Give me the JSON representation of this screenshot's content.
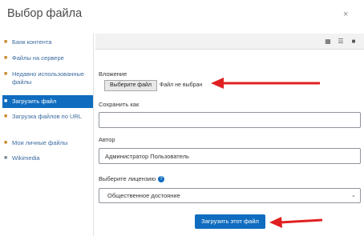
{
  "dialog": {
    "title": "Выбор файла",
    "close_icon": "×"
  },
  "sidebar": {
    "items": [
      {
        "label": "Банк контента",
        "icon": "folder-icon"
      },
      {
        "label": "Файлы на сервере",
        "icon": "folder-icon"
      },
      {
        "label": "Недавно использованные файлы",
        "icon": "folder-icon"
      },
      {
        "label": "Загрузить файл",
        "icon": "upload-icon",
        "active": true
      },
      {
        "label": "Загрузка файлов по URL",
        "icon": "url-icon"
      },
      {
        "label": "Мои личные файлы",
        "icon": "folder-icon"
      },
      {
        "label": "Wikimedia",
        "icon": "wikimedia-icon"
      }
    ]
  },
  "toolbar": {
    "views": [
      "grid-view-icon",
      "list-view-icon",
      "folder-view-icon"
    ]
  },
  "form": {
    "attachment_label": "Вложение",
    "choose_button": "Выберите файл",
    "no_file": "Файл не выбран",
    "save_as_label": "Сохранить как",
    "save_as_value": "",
    "author_label": "Автор",
    "author_value": "Администратор Пользователь",
    "license_label": "Выберите лицензию",
    "license_value": "Общественное достояние",
    "submit": "Загрузить этот файл"
  },
  "colors": {
    "primary": "#0f6cbf",
    "arrow": "#e02020",
    "link": "#3b6aa0"
  }
}
